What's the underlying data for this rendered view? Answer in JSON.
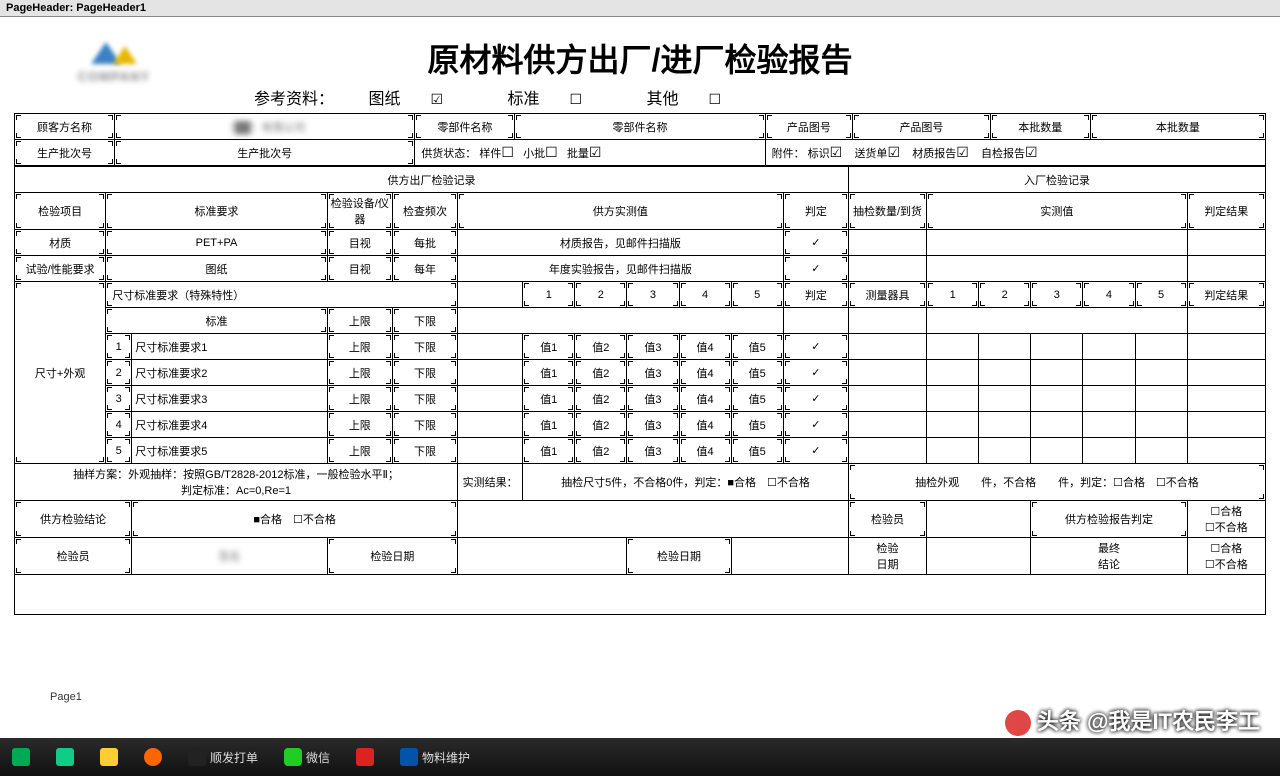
{
  "designer": {
    "header": "PageHeader: PageHeader1",
    "footer": "Page1"
  },
  "title": "原材料供方出厂/进厂检验报告",
  "ref": {
    "label": "参考资料：",
    "drawing": "图纸",
    "drawing_chk": true,
    "standard": "标准",
    "standard_chk": false,
    "other": "其他",
    "other_chk": false
  },
  "row1": {
    "customer_lbl": "顾客方名称",
    "customer_val": "（██）有限公司",
    "part_lbl": "零部件名称",
    "part_val": "零部件名称",
    "drawno_lbl": "产品图号",
    "drawno_val": "产品图号",
    "qty_lbl": "本批数量",
    "qty_val": "本批数量"
  },
  "row2": {
    "batch_lbl": "生产批次号",
    "batch_val": "生产批次号",
    "supply_lbl": "供货状态：",
    "sample": "样件",
    "small": "小批",
    "mass": "批量",
    "attach_lbl": "附件：",
    "mark": "标识",
    "deliv": "送货单",
    "matrep": "材质报告",
    "selfrep": "自检报告"
  },
  "section": {
    "out": "供方出厂检验记录",
    "in": "入厂检验记录"
  },
  "head": {
    "item": "检验项目",
    "req": "标准要求",
    "equip": "检验设备/仪器",
    "freq": "检查频次",
    "supval": "供方实测值",
    "judge": "判定",
    "sampqty": "抽检数量/到货",
    "inval": "实测值",
    "res": "判定结果"
  },
  "r_mat": {
    "item": "材质",
    "req": "PET+PA",
    "equip": "目视",
    "freq": "每批",
    "val": "材质报告，见邮件扫描版",
    "judge": "✓"
  },
  "r_perf": {
    "item": "试验/性能要求",
    "req": "图纸",
    "equip": "目视",
    "freq": "每年",
    "val": "年度实验报告，见邮件扫描版",
    "judge": "✓"
  },
  "dimhead": {
    "label": "尺寸标准要求（特殊特性）",
    "n1": "1",
    "n2": "2",
    "n3": "3",
    "n4": "4",
    "n5": "5",
    "judge": "判定",
    "tool": "测量器具",
    "res": "判定结果"
  },
  "stdrow": {
    "std": "标准",
    "up": "上限",
    "low": "下限"
  },
  "dims_label": "尺寸+外观",
  "dims": [
    {
      "idx": "1",
      "name": "尺寸标准要求1",
      "up": "上限",
      "low": "下限",
      "v1": "值1",
      "v2": "值2",
      "v3": "值3",
      "v4": "值4",
      "v5": "值5",
      "j": "✓"
    },
    {
      "idx": "2",
      "name": "尺寸标准要求2",
      "up": "上限",
      "low": "下限",
      "v1": "值1",
      "v2": "值2",
      "v3": "值3",
      "v4": "值4",
      "v5": "值5",
      "j": "✓"
    },
    {
      "idx": "3",
      "name": "尺寸标准要求3",
      "up": "上限",
      "low": "下限",
      "v1": "值1",
      "v2": "值2",
      "v3": "值3",
      "v4": "值4",
      "v5": "值5",
      "j": "✓"
    },
    {
      "idx": "4",
      "name": "尺寸标准要求4",
      "up": "上限",
      "low": "下限",
      "v1": "值1",
      "v2": "值2",
      "v3": "值3",
      "v4": "值4",
      "v5": "值5",
      "j": "✓"
    },
    {
      "idx": "5",
      "name": "尺寸标准要求5",
      "up": "上限",
      "low": "下限",
      "v1": "值1",
      "v2": "值2",
      "v3": "值3",
      "v4": "值4",
      "v5": "值5",
      "j": "✓"
    }
  ],
  "sampling": {
    "left": "抽样方案：外观抽样：按照GB/T2828-2012标准，一般检验水平Ⅱ；\n判定标准：Ac=0,Re=1",
    "midlbl": "实测结果：",
    "mid": "抽检尺寸5件，不合格0件，判定：■合格　☐不合格",
    "right": "抽检外观　　件，不合格　　件，判定：☐合格　☐不合格"
  },
  "concl": {
    "sup_lbl": "供方检验结论",
    "sup_val": "■合格　☐不合格",
    "inspector": "检验员",
    "rep_judge": "供方检验报告判定",
    "ok": "☐合格",
    "ng": "☐不合格"
  },
  "sign": {
    "inspector": "检验员",
    "date": "检验日期",
    "date2": "检验日期",
    "date3": "检验\n日期",
    "final": "最终\n结论",
    "ok": "☐合格",
    "ng": "☐不合格"
  },
  "taskbar": {
    "items": [
      "顺发打单",
      "微信",
      "物料维护"
    ]
  },
  "watermark": "头条 @我是IT农民李工"
}
